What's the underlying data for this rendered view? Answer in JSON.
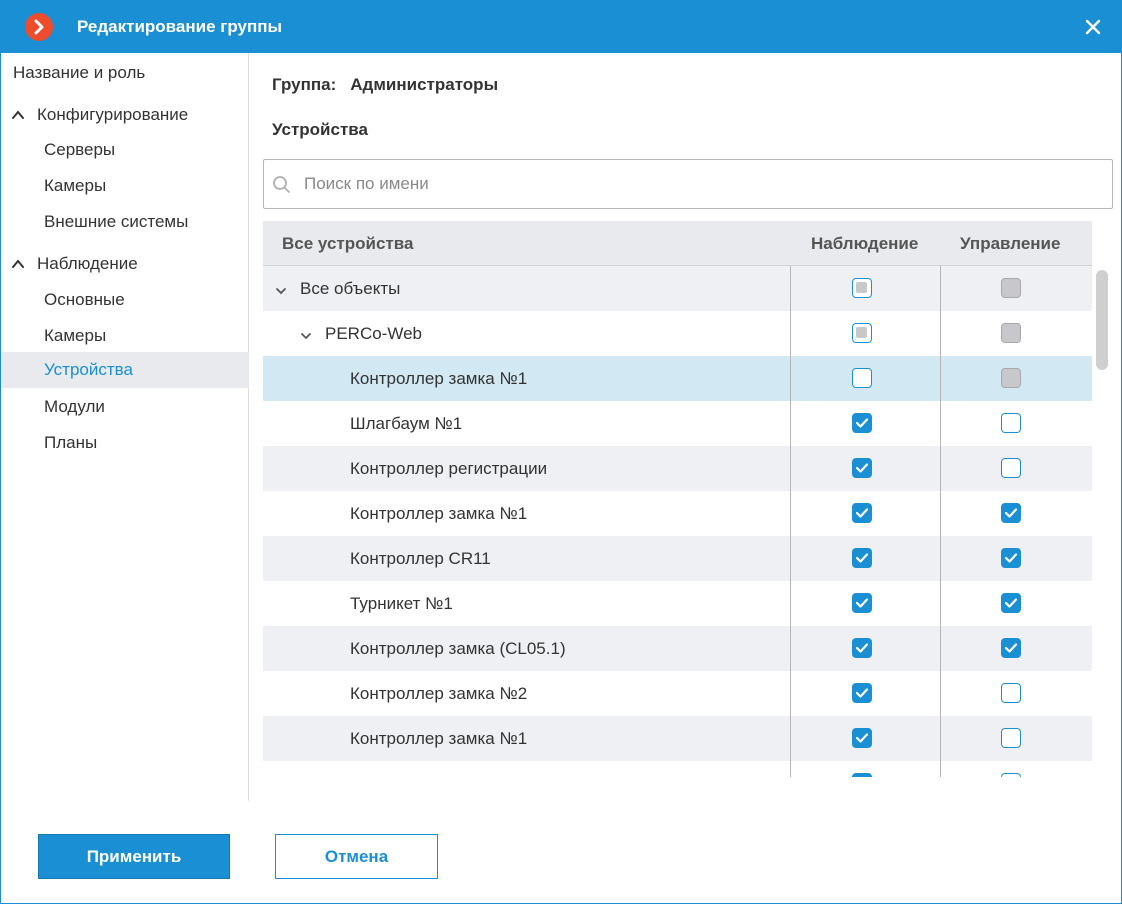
{
  "window": {
    "title": "Редактирование группы",
    "accent_color": "#1a8fd3",
    "logo_color": "#ee4d2d"
  },
  "sidebar": {
    "items": [
      {
        "label": "Название и роль"
      },
      {
        "label": "Конфигурирование"
      },
      {
        "label": "Серверы"
      },
      {
        "label": "Камеры"
      },
      {
        "label": "Внешние системы"
      },
      {
        "label": "Наблюдение"
      },
      {
        "label": "Основные"
      },
      {
        "label": "Камеры"
      },
      {
        "label": "Устройства",
        "selected": true
      },
      {
        "label": "Модули"
      },
      {
        "label": "Планы"
      }
    ]
  },
  "main": {
    "group_label": "Группа:",
    "group_value": "Администраторы",
    "section_title": "Устройства",
    "search_placeholder": "Поиск по имени",
    "search_value": ""
  },
  "table": {
    "columns": [
      "Все устройства",
      "Наблюдение",
      "Управление"
    ],
    "rows": [
      {
        "label": "Все объекты",
        "observe": "partial",
        "control": "disabled"
      },
      {
        "label": "PERCo-Web",
        "observe": "partial",
        "control": "disabled"
      },
      {
        "label": "Контроллер замка №1",
        "observe": "unchecked",
        "control": "disabled",
        "selected": true
      },
      {
        "label": "Шлагбаум №1",
        "observe": "checked",
        "control": "unchecked"
      },
      {
        "label": "Контроллер регистрации",
        "observe": "checked",
        "control": "unchecked"
      },
      {
        "label": "Контроллер замка №1",
        "observe": "checked",
        "control": "checked"
      },
      {
        "label": "Контроллер CR11",
        "observe": "checked",
        "control": "checked"
      },
      {
        "label": "Турникет №1",
        "observe": "checked",
        "control": "checked"
      },
      {
        "label": "Контроллер замка (CL05.1)",
        "observe": "checked",
        "control": "checked"
      },
      {
        "label": "Контроллер замка №2",
        "observe": "checked",
        "control": "unchecked"
      },
      {
        "label": "Контроллер замка №1",
        "observe": "checked",
        "control": "unchecked"
      },
      {
        "label": "",
        "observe": "checked",
        "control": "unchecked"
      }
    ]
  },
  "footer": {
    "apply_label": "Применить",
    "cancel_label": "Отмена"
  }
}
